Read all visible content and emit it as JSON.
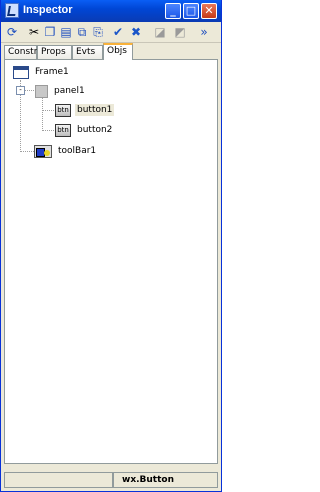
{
  "window": {
    "title": "Inspector"
  },
  "tabs": [
    {
      "label": "Constr"
    },
    {
      "label": "Props"
    },
    {
      "label": "Evts"
    },
    {
      "label": "Objs",
      "active": true
    }
  ],
  "tree": {
    "root": {
      "label": "Frame1",
      "icon": "frame-icon"
    },
    "panel": {
      "label": "panel1",
      "icon": "panel-icon",
      "expander": "-"
    },
    "buttons": [
      {
        "label": "button1",
        "icon": "button-icon",
        "icon_text": "btn",
        "selected": true
      },
      {
        "label": "button2",
        "icon": "button-icon",
        "icon_text": "btn"
      }
    ],
    "toolbar": {
      "label": "toolBar1",
      "icon": "toolbar-icon"
    }
  },
  "statusbar": {
    "class_name": "wx.Button"
  }
}
